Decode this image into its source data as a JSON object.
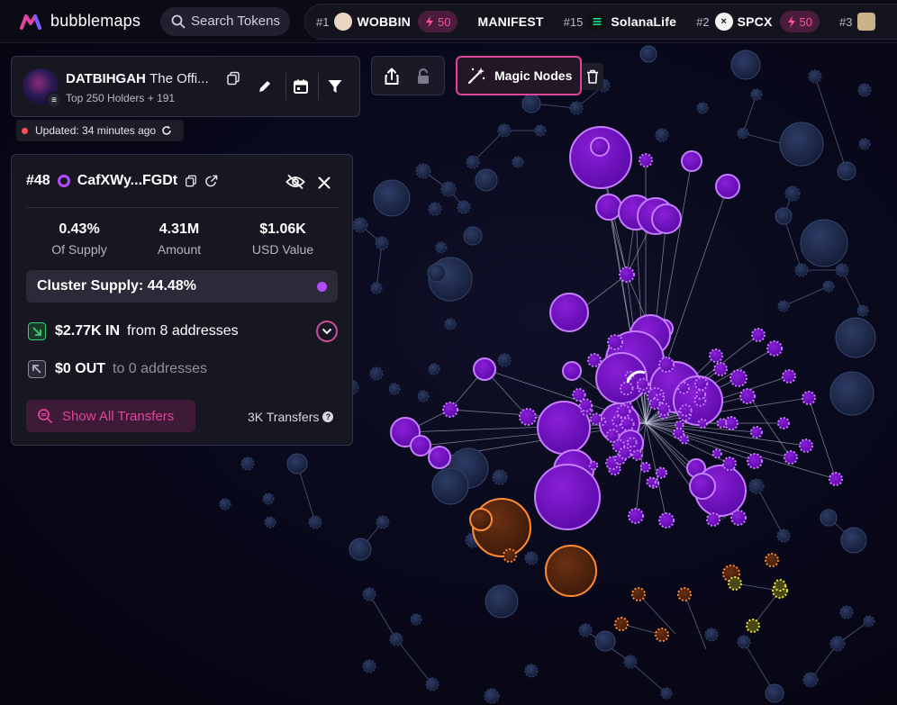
{
  "app": {
    "name": "bubblemaps"
  },
  "search": {
    "label": "Search Tokens"
  },
  "ticker": [
    {
      "rank": "#1",
      "symbol": "WOBBIN",
      "boost": "50",
      "icon_color": "#e9d7c4"
    },
    {
      "rank": "",
      "symbol": "MANIFEST",
      "boost": "",
      "icon_color": ""
    },
    {
      "rank": "#15",
      "symbol": "SolanaLife",
      "boost": "",
      "icon_color": "#14f195"
    },
    {
      "rank": "#2",
      "symbol": "SPCX",
      "boost": "50",
      "icon_color": "#111111"
    },
    {
      "rank": "#3",
      "symbol": "",
      "boost": "",
      "icon_color": "#c9b48a"
    }
  ],
  "token": {
    "name": "DATBIHGAH",
    "subtitle": "The Offi...",
    "holders": "Top 250 Holders + 191"
  },
  "updated": {
    "text": "Updated: 34 minutes ago"
  },
  "toolbar": {
    "magic_label": "Magic Nodes"
  },
  "wallet": {
    "rank": "#48",
    "address": "CafXWy...FGDt",
    "stats": [
      {
        "value": "0.43%",
        "label": "Of Supply"
      },
      {
        "value": "4.31M",
        "label": "Amount"
      },
      {
        "value": "$1.06K",
        "label": "USD Value"
      }
    ],
    "cluster": "Cluster Supply: 44.48%",
    "in_amount": "$2.77K IN",
    "in_from": "from 8 addresses",
    "out_amount": "$0 OUT",
    "out_to": "to 0 addresses",
    "show_transfers": "Show All Transfers",
    "transfers_count": "3K Transfers"
  },
  "colors": {
    "accent_pink": "#e0459c",
    "purple": "#b44bff",
    "orange": "#ff8a30",
    "yellow": "#e8e040",
    "bubble_blue": "#1c2848"
  }
}
